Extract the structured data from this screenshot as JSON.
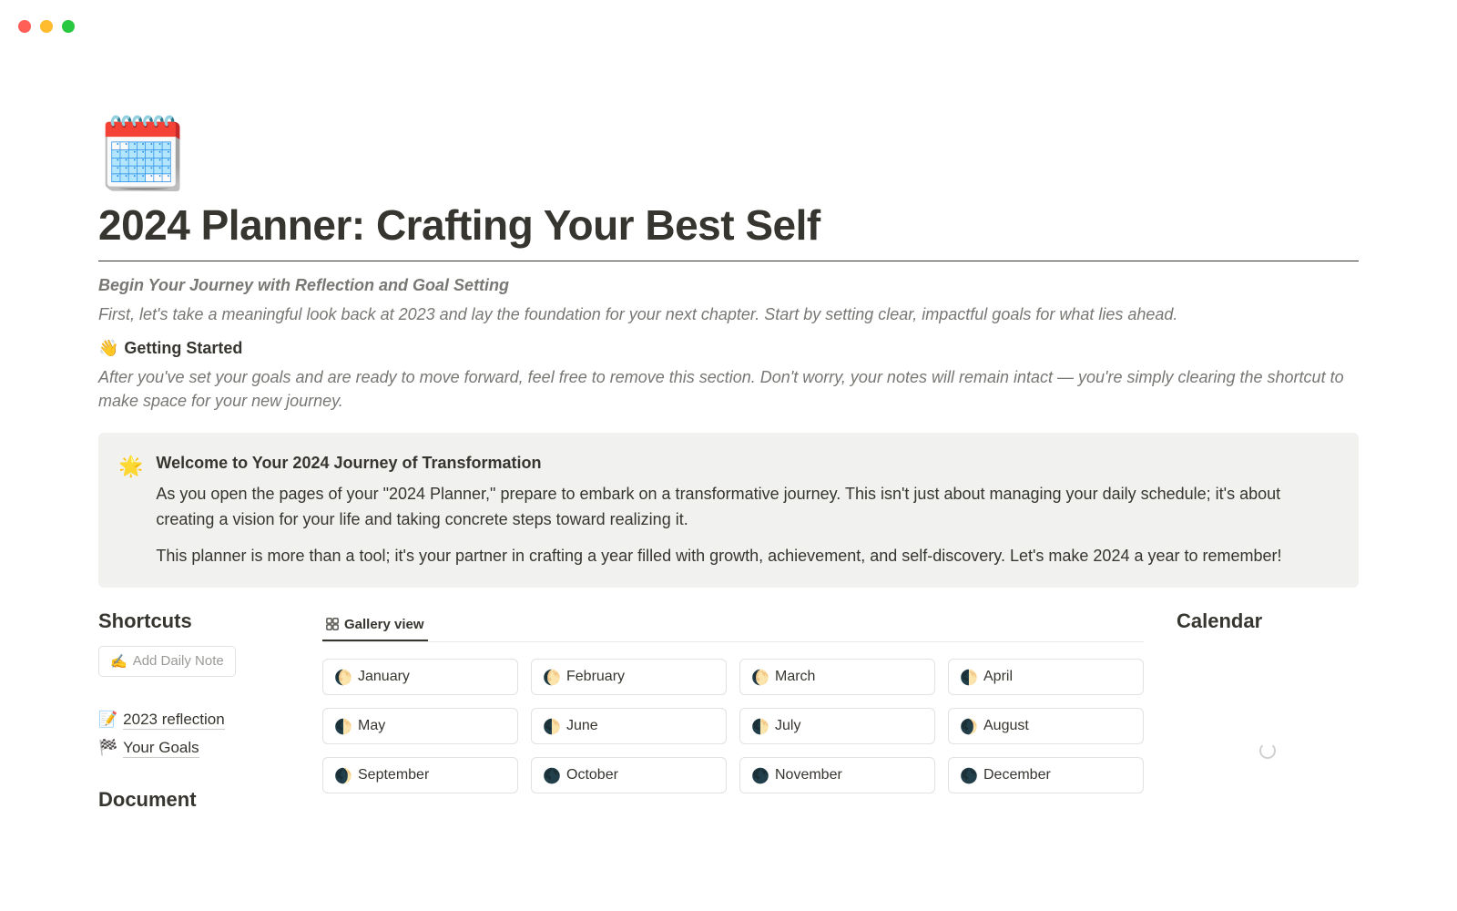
{
  "page": {
    "icon": "🗓️",
    "title": "2024 Planner: Crafting Your Best Self",
    "subtitle_bold": "Begin Your Journey with Reflection and Goal Setting",
    "intro": "First, let's take a meaningful look back at 2023 and lay the foundation for your next chapter. Start by setting clear, impactful goals for what lies ahead.",
    "getting_started": {
      "emoji": "👋",
      "label": "Getting Started"
    },
    "after_goals": "After you've set your goals and are ready to move forward, feel free to remove this section. Don't worry, your notes will remain intact — you're simply clearing the shortcut to make space for your new journey."
  },
  "callout": {
    "emoji": "🌟",
    "title": "Welcome to Your 2024 Journey of Transformation",
    "p1": "As you open the pages of your \"2024 Planner,\" prepare to embark on a transformative journey. This isn't just about managing your daily schedule; it's about creating a vision for your life and taking concrete steps toward realizing it.",
    "p2": "This planner is more than a tool; it's your partner in crafting a year filled with growth, achievement, and self-discovery. Let's make 2024 a year to remember!"
  },
  "shortcuts": {
    "heading": "Shortcuts",
    "add_daily": {
      "emoji": "✍️",
      "label": "Add Daily Note"
    },
    "links": [
      {
        "emoji": "📝",
        "label": "2023 reflection"
      },
      {
        "emoji": "🏁",
        "label": "Your Goals"
      }
    ],
    "document_heading": "Document"
  },
  "gallery": {
    "view_label": "Gallery view",
    "months": [
      {
        "emoji": "🌔",
        "name": "January"
      },
      {
        "emoji": "🌔",
        "name": "February"
      },
      {
        "emoji": "🌔",
        "name": "March"
      },
      {
        "emoji": "🌓",
        "name": "April"
      },
      {
        "emoji": "🌓",
        "name": "May"
      },
      {
        "emoji": "🌓",
        "name": "June"
      },
      {
        "emoji": "🌓",
        "name": "July"
      },
      {
        "emoji": "🌒",
        "name": "August"
      },
      {
        "emoji": "🌒",
        "name": "September"
      },
      {
        "emoji": "🌑",
        "name": "October"
      },
      {
        "emoji": "🌑",
        "name": "November"
      },
      {
        "emoji": "🌑",
        "name": "December"
      }
    ]
  },
  "calendar": {
    "heading": "Calendar"
  }
}
